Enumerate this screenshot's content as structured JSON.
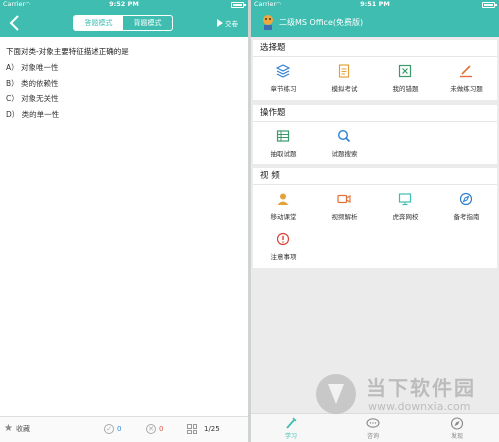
{
  "left": {
    "status": {
      "carrier": "Carrier",
      "time": "9:52 PM"
    },
    "nav": {
      "tabs": [
        "答题模式",
        "背题模式"
      ],
      "active_tab": 0,
      "submit_label": "交卷"
    },
    "question": {
      "text": "下面对类-对象主要特征描述正确的是",
      "options": [
        "A） 对象唯一性",
        "B） 类的依赖性",
        "C） 对象无关性",
        "D） 类的单一性"
      ]
    },
    "bottom": {
      "favorite_label": "收藏",
      "correct_count": "0",
      "wrong_count": "0",
      "progress": "1/25"
    }
  },
  "right": {
    "status": {
      "carrier": "Carrier",
      "time": "9:51 PM"
    },
    "app_title": "二级MS Office(免费版)",
    "sections": [
      {
        "title": "选择题",
        "items": [
          {
            "label": "章节练习",
            "icon": "layers-icon",
            "color": "#2f7fd0"
          },
          {
            "label": "模拟考试",
            "icon": "document-icon",
            "color": "#e3a23b"
          },
          {
            "label": "我的错题",
            "icon": "error-sheet-icon",
            "color": "#3a9a6a"
          },
          {
            "label": "未做练习题",
            "icon": "pen-icon",
            "color": "#e2703a"
          }
        ]
      },
      {
        "title": "操作题",
        "items": [
          {
            "label": "抽取试题",
            "icon": "table-icon",
            "color": "#3a9a6a"
          },
          {
            "label": "试题搜索",
            "icon": "search-icon",
            "color": "#2f7fd0"
          }
        ]
      },
      {
        "title": "视 频",
        "items": [
          {
            "label": "移动课堂",
            "icon": "user-icon",
            "color": "#e3a23b"
          },
          {
            "label": "视频解析",
            "icon": "video-icon",
            "color": "#e2703a"
          },
          {
            "label": "虎奔网校",
            "icon": "monitor-icon",
            "color": "#3fbdb1"
          },
          {
            "label": "备考指南",
            "icon": "compass-icon",
            "color": "#2f7fd0"
          },
          {
            "label": "注意事项",
            "icon": "alert-icon",
            "color": "#d9433a"
          }
        ]
      }
    ],
    "tabbar": {
      "tabs": [
        "学习",
        "咨询",
        "发现"
      ],
      "active": 0
    }
  },
  "watermark": {
    "name": "当下软件园",
    "url": "www.downxia.com"
  }
}
